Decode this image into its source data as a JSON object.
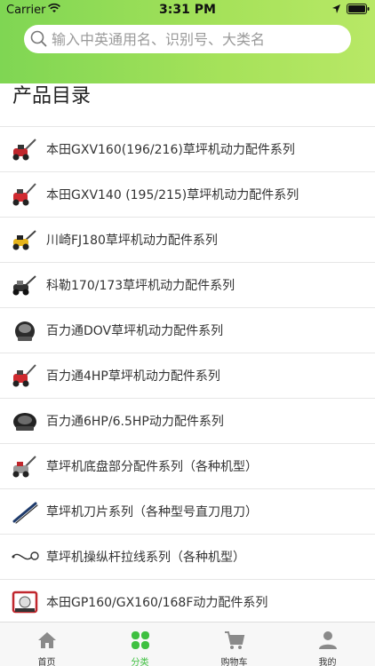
{
  "status_bar": {
    "carrier": "Carrier",
    "time": "3:31 PM"
  },
  "search": {
    "placeholder": "输入中英通用名、识别号、大类名"
  },
  "page": {
    "title": "产品目录"
  },
  "catalog": {
    "items": [
      {
        "label": "本田GXV160(196/216)草坪机动力配件系列",
        "icon": "mower-icon"
      },
      {
        "label": "本田GXV140 (195/215)草坪机动力配件系列",
        "icon": "mower-icon"
      },
      {
        "label": "川崎FJ180草坪机动力配件系列",
        "icon": "mower-icon"
      },
      {
        "label": "科勒170/173草坪机动力配件系列",
        "icon": "mower-icon"
      },
      {
        "label": "百力通DOV草坪机动力配件系列",
        "icon": "engine-icon"
      },
      {
        "label": "百力通4HP草坪机动力配件系列",
        "icon": "mower-icon"
      },
      {
        "label": "百力通6HP/6.5HP动力配件系列",
        "icon": "engine-icon"
      },
      {
        "label": "草坪机底盘部分配件系列（各种机型）",
        "icon": "mower-icon"
      },
      {
        "label": "草坪机刀片系列（各种型号直刀甩刀）",
        "icon": "blade-icon"
      },
      {
        "label": "草坪机操纵杆拉线系列（各种机型）",
        "icon": "cable-icon"
      },
      {
        "label": "本田GP160/GX160/168F动力配件系列",
        "icon": "generator-icon"
      }
    ]
  },
  "tabs": [
    {
      "label": "首页",
      "icon": "home-icon",
      "active": false
    },
    {
      "label": "分类",
      "icon": "category-icon",
      "active": true
    },
    {
      "label": "购物车",
      "icon": "cart-icon",
      "active": false
    },
    {
      "label": "我的",
      "icon": "user-icon",
      "active": false
    }
  ],
  "colors": {
    "header_gradient_start": "#7fd653",
    "header_gradient_end": "#b8e866",
    "active_tab": "#3ec040"
  }
}
